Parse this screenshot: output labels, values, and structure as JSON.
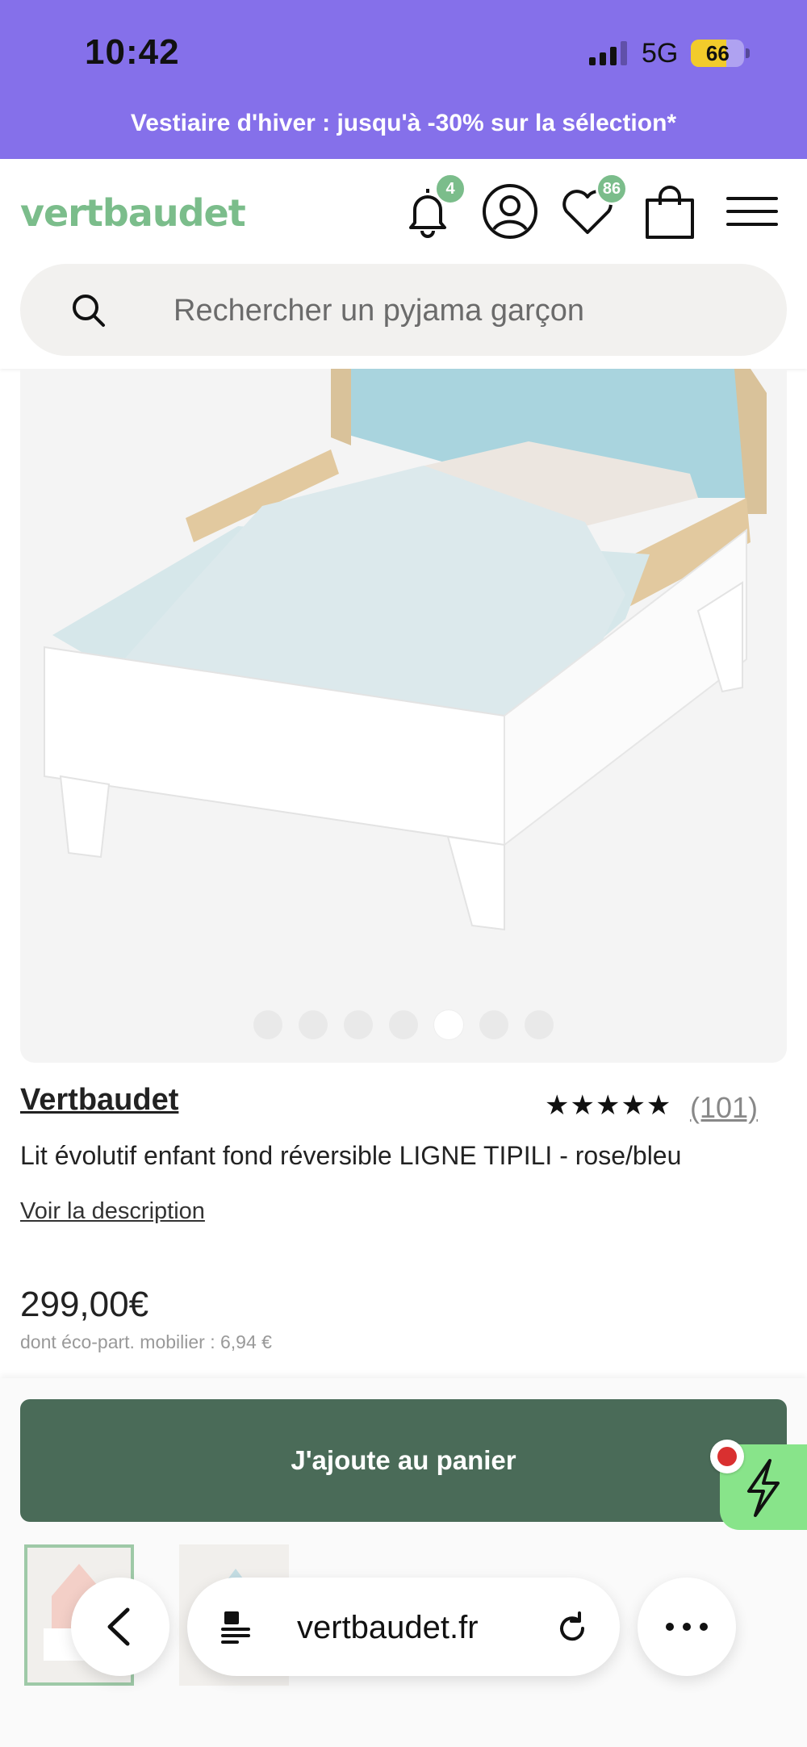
{
  "status_bar": {
    "time": "10:42",
    "network": "5G",
    "battery": "66"
  },
  "promo": {
    "text": "Vestiaire d'hiver : jusqu'à -30% sur la sélection*"
  },
  "header": {
    "logo": "vertbaudet",
    "notifications_count": "4",
    "wishlist_count": "86",
    "icons": [
      "bell-icon",
      "account-icon",
      "heart-icon",
      "shopping-bag-icon",
      "menu-icon"
    ]
  },
  "search": {
    "placeholder": "Rechercher un pyjama garçon"
  },
  "product": {
    "image_count": 7,
    "active_image_index": 4,
    "brand": "Vertbaudet",
    "rating_stars": "★★★★★",
    "rating": 4.5,
    "reviews": "(101)",
    "title": "Lit évolutif enfant fond réversible LIGNE TIPILI - rose/bleu",
    "description_link": "Voir la description",
    "price": "299,00€",
    "eco_participation": "dont éco-part. mobilier : 6,94 €",
    "add_to_cart": "J'ajoute au panier"
  },
  "browser": {
    "url": "vertbaudet.fr"
  },
  "colors": {
    "purple": "#8570ea",
    "brand_green": "#7bbd8b",
    "button_green": "#4a6b58",
    "zap_green": "#88e48a"
  }
}
